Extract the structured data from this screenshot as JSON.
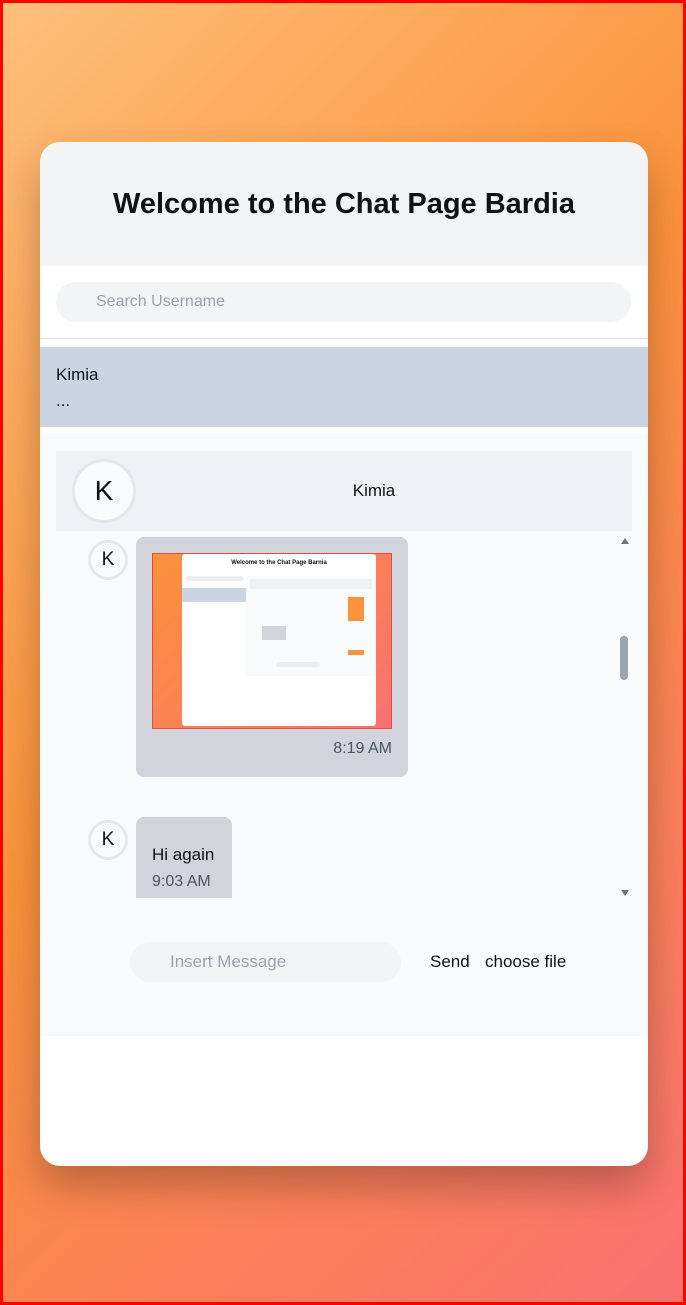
{
  "header": {
    "title": "Welcome to the Chat Page Bardia"
  },
  "search": {
    "placeholder": "Search Username",
    "value": ""
  },
  "contacts": [
    {
      "name": "Kimia",
      "preview": "..."
    }
  ],
  "chat": {
    "contact_name": "Kimia",
    "avatar_initial": "K",
    "messages": [
      {
        "sender_initial": "K",
        "type": "image",
        "time": "8:19 AM",
        "image_title": "Welcome to the Chat Page Barnia"
      },
      {
        "sender_initial": "K",
        "type": "text",
        "text": "Hi again",
        "time": "9:03 AM"
      }
    ]
  },
  "composer": {
    "placeholder": "Insert Message",
    "send_label": "Send",
    "file_label": "choose file"
  },
  "colors": {
    "accent": "#fb923c",
    "selected_contact": "#cbd5e1",
    "bubble": "#d1d5db"
  }
}
